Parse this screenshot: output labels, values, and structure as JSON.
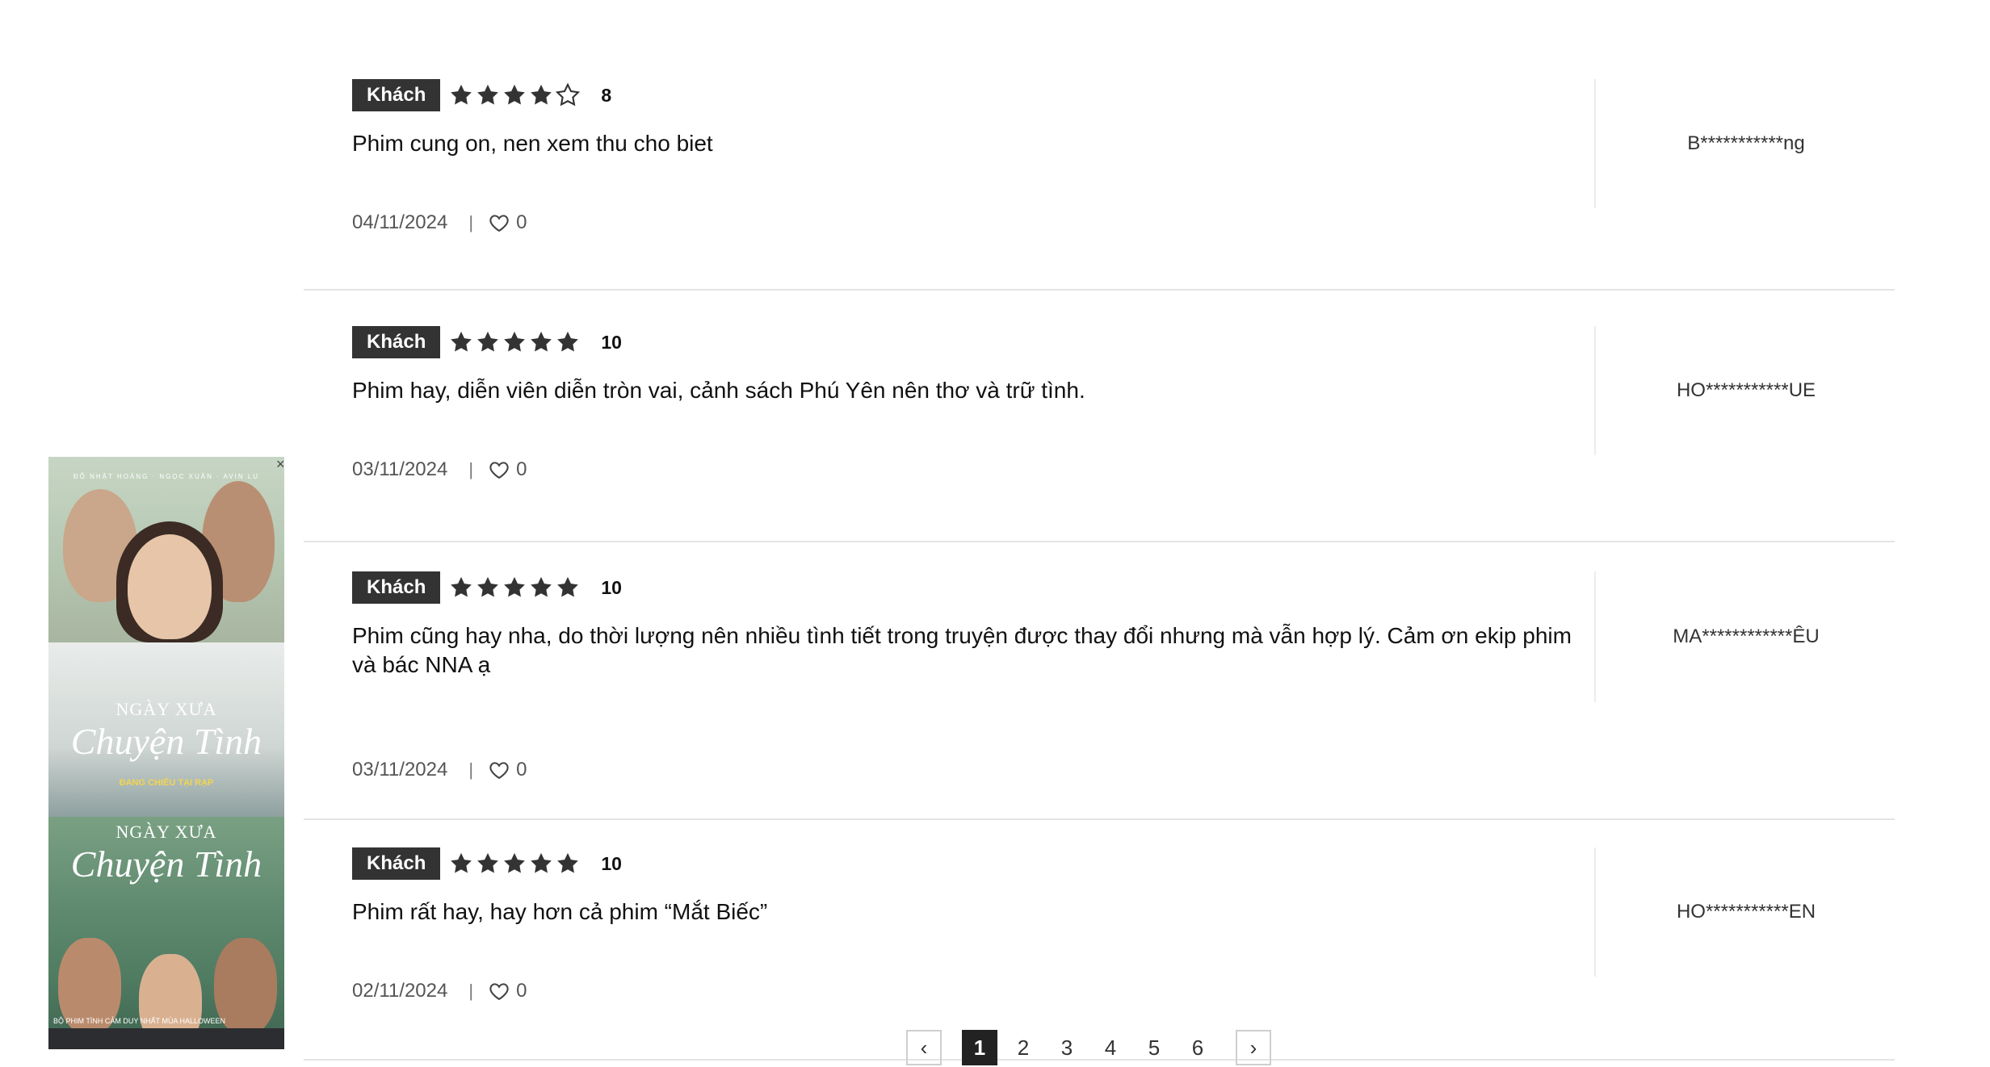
{
  "banner": {
    "poster_1": {
      "credit": "ĐỖ NHẬT HOÀNG · NGỌC XUÂN · AVIN LU",
      "title_small": "NGÀY XƯA",
      "title_script": "Chuyện Tình",
      "tag": "ĐANG CHIẾU TẠI RẠP"
    },
    "poster_2": {
      "title_small": "NGÀY XƯA",
      "title_script": "Chuyện Tình",
      "bottom_text": "BỘ PHIM TÌNH CẢM DUY NHẤT MÙA HALLOWEEN"
    },
    "close_icon": "×"
  },
  "reviews": [
    {
      "badge": "Khách",
      "rating_stars": 4,
      "score": "8",
      "text": "Phim cung on, nen xem thu cho biet",
      "date": "04/11/2024",
      "likes": "0",
      "user": "B***********ng"
    },
    {
      "badge": "Khách",
      "rating_stars": 5,
      "score": "10",
      "text": "Phim hay, diễn viên diễn tròn vai, cảnh sách Phú Yên nên thơ và trữ tình.",
      "date": "03/11/2024",
      "likes": "0",
      "user": "HO***********UE"
    },
    {
      "badge": "Khách",
      "rating_stars": 5,
      "score": "10",
      "text": "Phim cũng hay nha, do thời lượng nên nhiều tình tiết trong truyện được thay đổi nhưng mà vẫn hợp lý. Cảm ơn ekip phim và bác NNA ạ",
      "date": "03/11/2024",
      "likes": "0",
      "user": "MA************ÊU"
    },
    {
      "badge": "Khách",
      "rating_stars": 5,
      "score": "10",
      "text": "Phim rất hay, hay hơn cả phim “Mắt Biếc”",
      "date": "02/11/2024",
      "likes": "0",
      "user": "HO***********EN"
    }
  ],
  "pagination": {
    "prev": "‹",
    "next": "›",
    "pages": [
      "1",
      "2",
      "3",
      "4",
      "5",
      "6"
    ],
    "current": "1"
  },
  "colors": {
    "badge_bg": "#333333",
    "star_fill": "#333333",
    "divider": "#e4e4e4",
    "active_page": "#222222"
  }
}
